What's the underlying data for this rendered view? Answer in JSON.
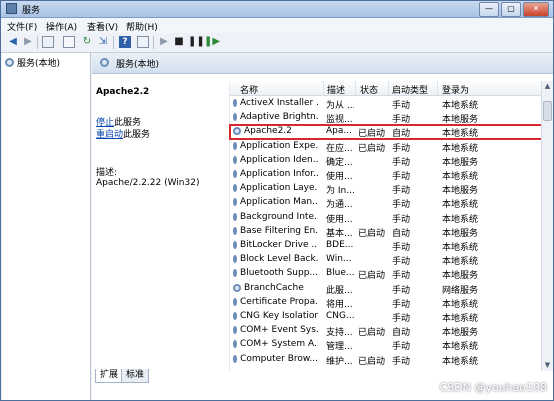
{
  "window": {
    "title": "服务"
  },
  "title_buttons": [
    "—",
    "▢",
    "✕"
  ],
  "menu": [
    "文件(F)",
    "操作(A)",
    "查看(V)",
    "帮助(H)"
  ],
  "toolbar_icons": [
    "back-icon",
    "forward-icon",
    "console-tree-icon",
    "properties-icon",
    "refresh-icon",
    "export-icon",
    "help-icon",
    "play-icon",
    "stop-icon",
    "pause-icon",
    "resume-icon"
  ],
  "tree": {
    "root": "服务(本地)"
  },
  "header": {
    "title": "服务(本地)"
  },
  "detail": {
    "service_name": "Apache2.2",
    "stop_link": "停止",
    "stop_suffix": "此服务",
    "restart_link": "重启动",
    "restart_suffix": "此服务",
    "desc_label": "描述:",
    "desc_value": "Apache/2.2.22 (Win32)"
  },
  "columns": [
    "名称",
    "描述",
    "状态",
    "启动类型",
    "登录为"
  ],
  "rows": [
    {
      "name": "ActiveX Installer ...",
      "desc": "为从 ...",
      "status": "",
      "start": "手动",
      "logon": "本地系统"
    },
    {
      "name": "Adaptive Brightn...",
      "desc": "监视...",
      "status": "",
      "start": "手动",
      "logon": "本地服务"
    },
    {
      "name": "Apache2.2",
      "desc": "Apa...",
      "status": "已启动",
      "start": "自动",
      "logon": "本地系统",
      "selected": true
    },
    {
      "name": "Application Expe...",
      "desc": "在应...",
      "status": "已启动",
      "start": "手动",
      "logon": "本地系统"
    },
    {
      "name": "Application Iden...",
      "desc": "确定...",
      "status": "",
      "start": "手动",
      "logon": "本地服务"
    },
    {
      "name": "Application Infor...",
      "desc": "使用...",
      "status": "",
      "start": "手动",
      "logon": "本地系统"
    },
    {
      "name": "Application Laye...",
      "desc": "为 In...",
      "status": "",
      "start": "手动",
      "logon": "本地服务"
    },
    {
      "name": "Application Man...",
      "desc": "为通...",
      "status": "",
      "start": "手动",
      "logon": "本地系统"
    },
    {
      "name": "Background Inte...",
      "desc": "使用...",
      "status": "",
      "start": "手动",
      "logon": "本地系统"
    },
    {
      "name": "Base Filtering En...",
      "desc": "基本...",
      "status": "已启动",
      "start": "自动",
      "logon": "本地服务"
    },
    {
      "name": "BitLocker Drive ...",
      "desc": "BDE...",
      "status": "",
      "start": "手动",
      "logon": "本地系统"
    },
    {
      "name": "Block Level Back...",
      "desc": "Win...",
      "status": "",
      "start": "手动",
      "logon": "本地系统"
    },
    {
      "name": "Bluetooth Supp...",
      "desc": "Blue...",
      "status": "已启动",
      "start": "手动",
      "logon": "本地服务"
    },
    {
      "name": "BranchCache",
      "desc": "此服...",
      "status": "",
      "start": "手动",
      "logon": "网络服务"
    },
    {
      "name": "Certificate Propa...",
      "desc": "将用...",
      "status": "",
      "start": "手动",
      "logon": "本地系统"
    },
    {
      "name": "CNG Key Isolation",
      "desc": "CNG...",
      "status": "",
      "start": "手动",
      "logon": "本地系统"
    },
    {
      "name": "COM+ Event Sys...",
      "desc": "支持...",
      "status": "已启动",
      "start": "自动",
      "logon": "本地服务"
    },
    {
      "name": "COM+ System A...",
      "desc": "管理...",
      "status": "",
      "start": "手动",
      "logon": "本地系统"
    },
    {
      "name": "Computer Brow...",
      "desc": "维护...",
      "status": "已启动",
      "start": "手动",
      "logon": "本地系统"
    }
  ],
  "tabs": [
    "扩展",
    "标准"
  ],
  "watermark": "CSDN @youhao108"
}
